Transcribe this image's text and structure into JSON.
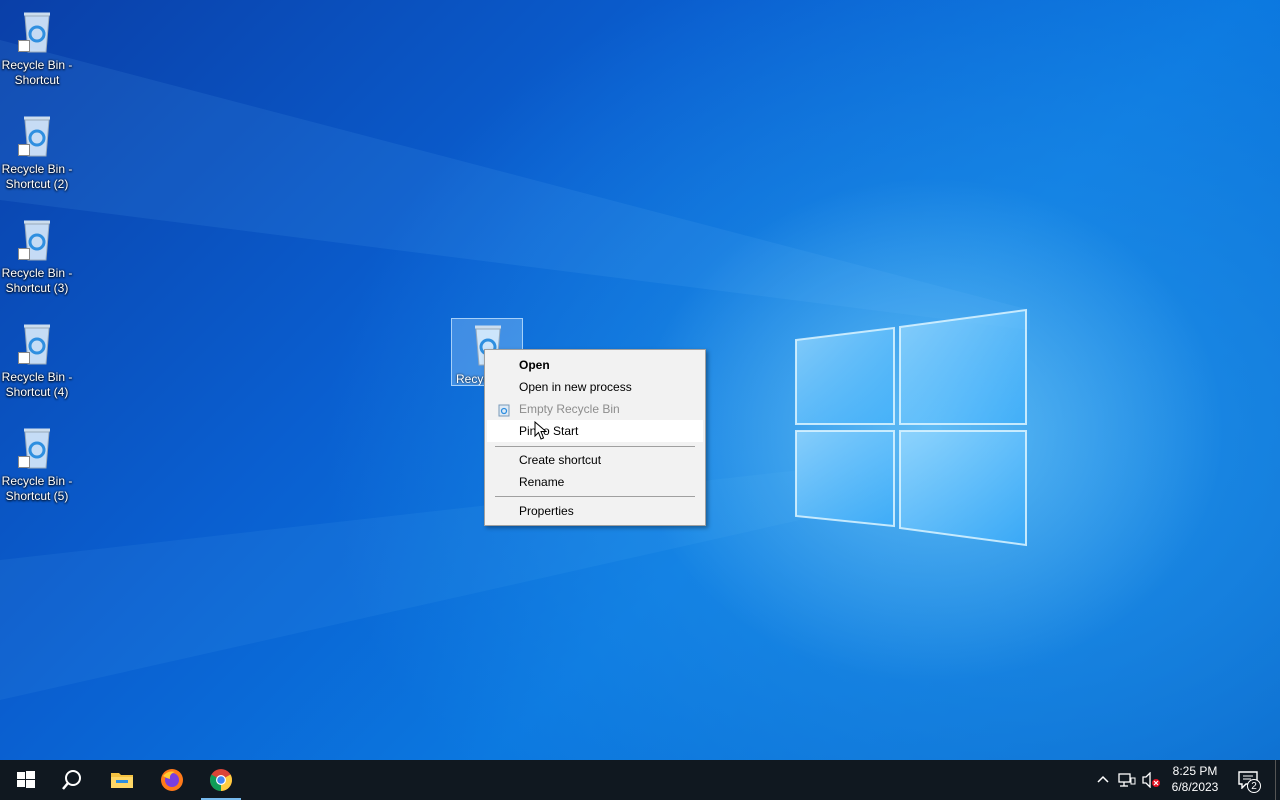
{
  "desktop": {
    "icons": [
      {
        "label": "Recycle Bin -\nShortcut"
      },
      {
        "label": "Recycle Bin -\nShortcut (2)"
      },
      {
        "label": "Recycle Bin -\nShortcut (3)"
      },
      {
        "label": "Recycle Bin -\nShortcut (4)"
      },
      {
        "label": "Recycle Bin -\nShortcut (5)"
      }
    ],
    "selected_icon": {
      "label": "Recyc"
    }
  },
  "context_menu": {
    "items": [
      {
        "label": "Open",
        "bold": true
      },
      {
        "label": "Open in new process"
      },
      {
        "label": "Empty Recycle Bin",
        "disabled": true,
        "icon": "recycle-bin-icon"
      },
      {
        "label": "Pin to Start",
        "hover": true
      },
      {
        "label": "Create shortcut"
      },
      {
        "label": "Rename"
      },
      {
        "label": "Properties"
      }
    ]
  },
  "taskbar": {
    "buttons": [
      {
        "name": "start-button",
        "icon": "windows-logo-icon"
      },
      {
        "name": "search-button",
        "icon": "search-icon"
      },
      {
        "name": "file-explorer-button",
        "icon": "folder-icon"
      },
      {
        "name": "firefox-button",
        "icon": "firefox-icon"
      },
      {
        "name": "chrome-button",
        "icon": "chrome-icon",
        "active": true
      }
    ],
    "tray": {
      "time": "8:25 PM",
      "date": "6/8/2023",
      "notification_count": "2"
    }
  },
  "colors": {
    "taskbar": "#101820",
    "menu_bg": "#f2f2f2",
    "accent": "#76b9ed"
  }
}
